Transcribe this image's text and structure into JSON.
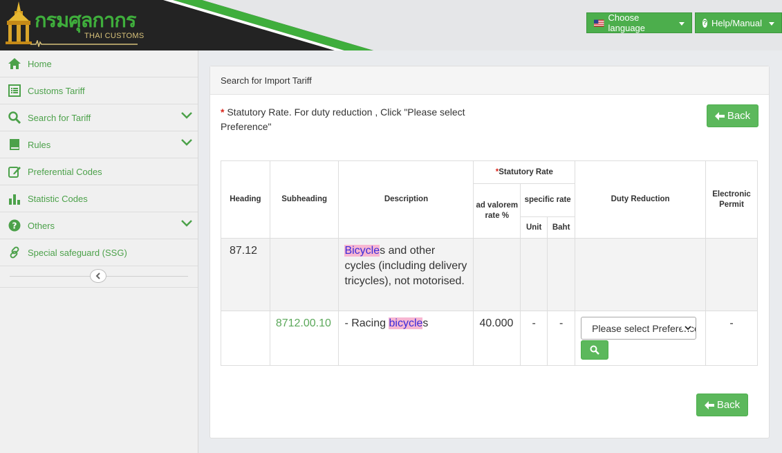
{
  "header": {
    "logo_th": "กรมศุลกากร",
    "logo_en": "THAI CUSTOMS",
    "language_label": "Choose language",
    "help_label": "Help/Manual",
    "colors": {
      "accent": "#4cae4c",
      "dark": "#222222",
      "green_stripe": "#3fae3c"
    }
  },
  "sidebar": {
    "items": [
      {
        "label": "Home",
        "icon": "home-icon"
      },
      {
        "label": "Customs Tariff",
        "icon": "list-icon"
      },
      {
        "label": "Search for Tariff",
        "icon": "search-icon",
        "expandable": true
      },
      {
        "label": "Rules",
        "icon": "book-icon",
        "expandable": true
      },
      {
        "label": "Preferential Codes",
        "icon": "edit-icon"
      },
      {
        "label": "Statistic Codes",
        "icon": "bar-chart-icon"
      },
      {
        "label": "Others",
        "icon": "question-icon",
        "expandable": true
      },
      {
        "label": "Special safeguard (SSG)",
        "icon": "link-icon"
      }
    ]
  },
  "panel": {
    "title": "Search for Import Tariff",
    "note_star": "*",
    "note_text": "Statutory Rate. For duty reduction , Click \"Please select Preference\"",
    "back_label": "Back"
  },
  "table": {
    "headers": {
      "heading": "Heading",
      "subheading": "Subheading",
      "description": "Description",
      "statutory_star": "*",
      "statutory": "Statutory Rate",
      "ad_valorem": "ad valorem rate %",
      "specific": "specific rate",
      "unit": "Unit",
      "baht": "Baht",
      "duty_reduction": "Duty Reduction",
      "electronic_permit": "Electronic Permit"
    },
    "row1": {
      "heading": "87.12",
      "desc_hl": "Bicycle",
      "desc_rest": "s and other cycles (including delivery tricycles), not motorised."
    },
    "row2": {
      "subheading": "8712.00.10",
      "desc_prefix": "- Racing ",
      "desc_hl": "bicycle",
      "desc_suffix": "s",
      "ad_valorem": "40.000",
      "unit": "-",
      "baht": "-",
      "preference_placeholder": "Please select Preference",
      "electronic_permit": "-"
    }
  }
}
